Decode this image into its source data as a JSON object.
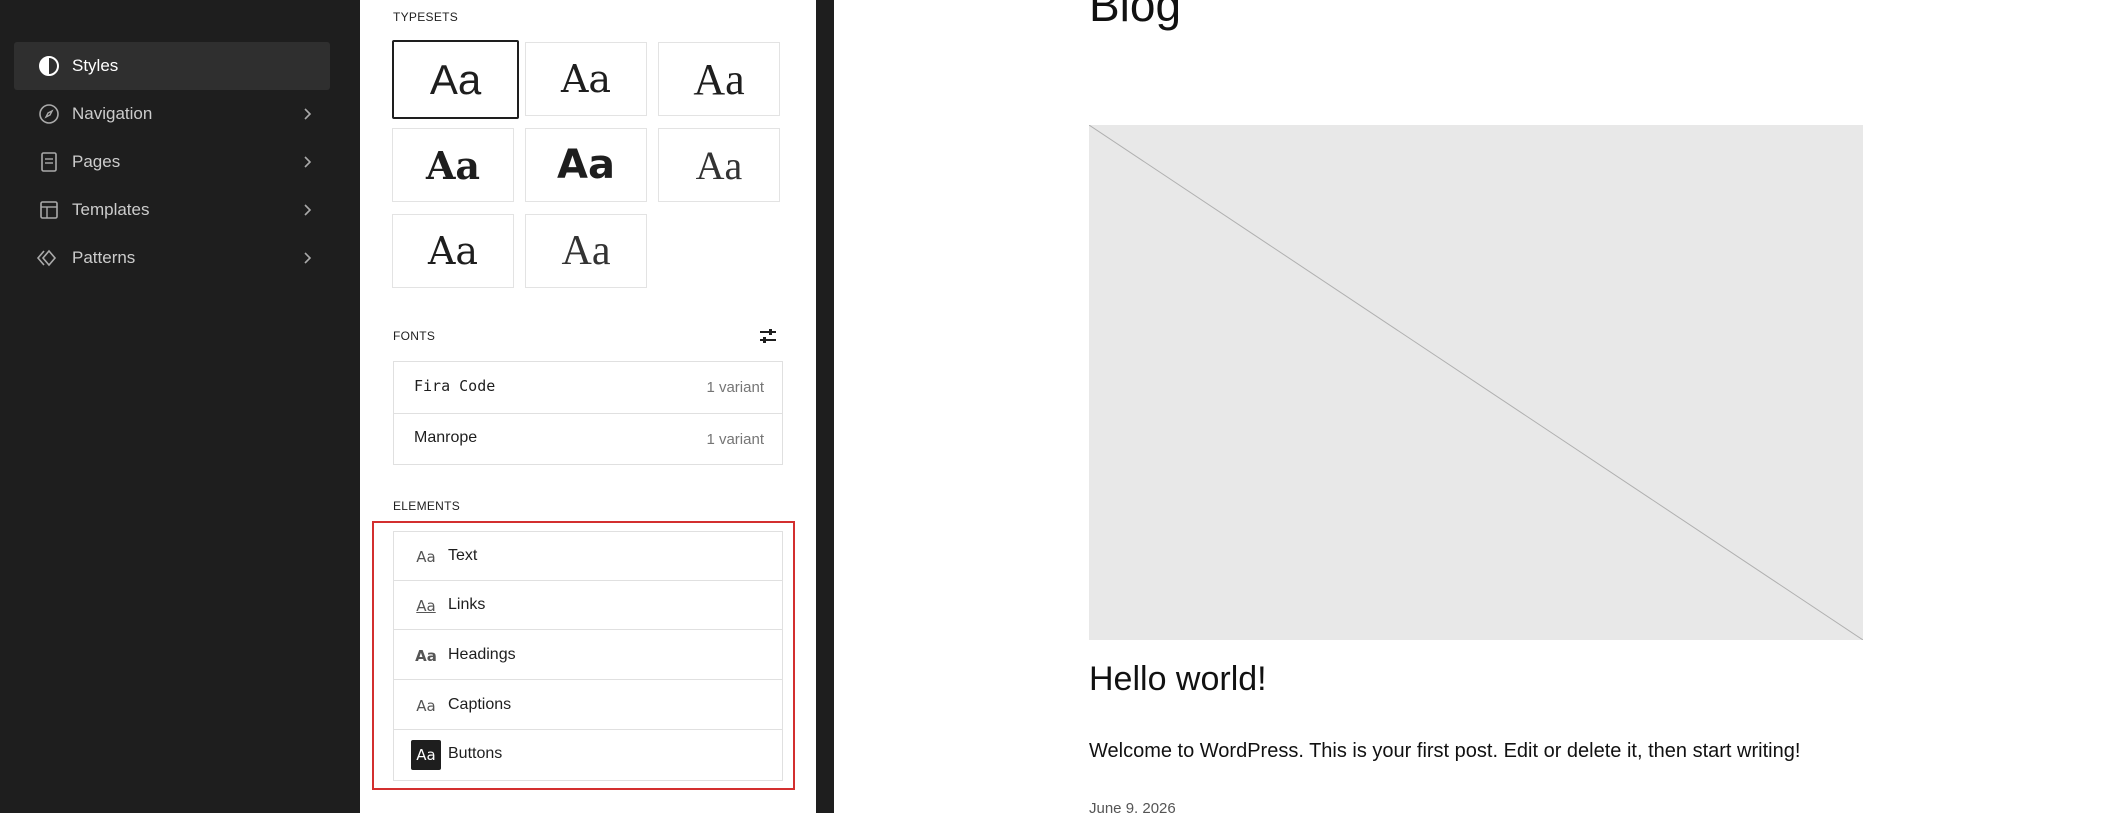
{
  "sidebar": {
    "items": [
      {
        "label": "Styles",
        "icon": "half-circle-icon",
        "active": true
      },
      {
        "label": "Navigation",
        "icon": "compass-icon"
      },
      {
        "label": "Pages",
        "icon": "page-icon"
      },
      {
        "label": "Templates",
        "icon": "layout-icon"
      },
      {
        "label": "Patterns",
        "icon": "diamond-icon"
      }
    ]
  },
  "panel": {
    "typesets_title": "TYPESETS",
    "typesets": [
      {
        "sample": "Aa"
      },
      {
        "sample": "Aa"
      },
      {
        "sample": "Aa"
      },
      {
        "sample": "Aa"
      },
      {
        "sample": "Aa"
      },
      {
        "sample": "Aa"
      },
      {
        "sample": "Aa"
      },
      {
        "sample": "Aa"
      }
    ],
    "fonts_title": "FONTS",
    "fonts": [
      {
        "name": "Fira Code",
        "variants": "1 variant"
      },
      {
        "name": "Manrope",
        "variants": "1 variant"
      }
    ],
    "elements_title": "ELEMENTS",
    "elements": [
      {
        "icon": "Aa",
        "label": "Text"
      },
      {
        "icon": "Aa",
        "label": "Links"
      },
      {
        "icon": "Aa",
        "label": "Headings"
      },
      {
        "icon": "Aa",
        "label": "Captions"
      },
      {
        "icon": "Aa",
        "label": "Buttons"
      }
    ]
  },
  "preview": {
    "page_title": "Blog",
    "post_title": "Hello world!",
    "post_excerpt": "Welcome to WordPress. This is your first post. Edit or delete it, then start writing!",
    "post_date": "June 9, 2026"
  },
  "colors": {
    "sidebar_bg": "#1e1e1e",
    "highlight": "#d32f2f"
  }
}
